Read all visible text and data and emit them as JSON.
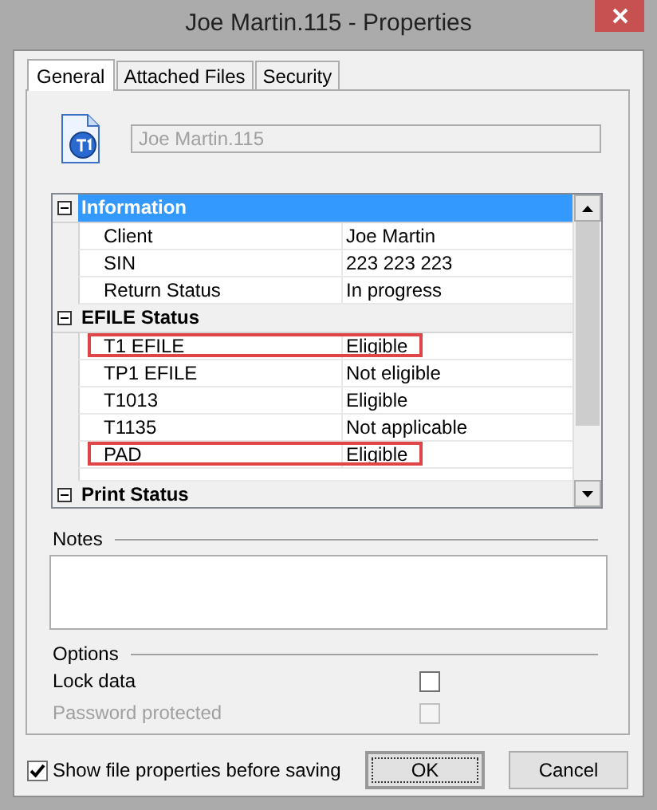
{
  "window": {
    "title": "Joe Martin.115 - Properties"
  },
  "tabs": [
    {
      "label": "General",
      "selected": true
    },
    {
      "label": "Attached Files",
      "selected": false
    },
    {
      "label": "Security",
      "selected": false
    }
  ],
  "file_name": {
    "value": "Joe Martin.115",
    "disabled": true
  },
  "properties": {
    "sections": [
      {
        "title": "Information",
        "selected": true,
        "expanded": true,
        "rows": [
          {
            "name": "Client",
            "value": "Joe Martin",
            "highlighted": false
          },
          {
            "name": "SIN",
            "value": "223 223 223",
            "highlighted": false
          },
          {
            "name": "Return Status",
            "value": "In progress",
            "highlighted": false
          }
        ]
      },
      {
        "title": "EFILE Status",
        "selected": false,
        "expanded": true,
        "rows": [
          {
            "name": "T1 EFILE",
            "value": "Eligible",
            "highlighted": true
          },
          {
            "name": "TP1 EFILE",
            "value": "Not eligible",
            "highlighted": false
          },
          {
            "name": "T1013",
            "value": "Eligible",
            "highlighted": false
          },
          {
            "name": "T1135",
            "value": "Not applicable",
            "highlighted": false
          },
          {
            "name": "PAD",
            "value": "Eligible",
            "highlighted": true
          }
        ]
      },
      {
        "title": "Print Status",
        "selected": false,
        "expanded": true
      }
    ]
  },
  "notes": {
    "label": "Notes"
  },
  "options": {
    "label": "Options",
    "items": [
      {
        "label": "Lock data",
        "checked": false,
        "disabled": false
      },
      {
        "label": "Password protected",
        "checked": false,
        "disabled": true
      }
    ]
  },
  "show_properties": {
    "label": "Show file properties before saving",
    "checked": true
  },
  "buttons": [
    {
      "label": "OK",
      "default": true
    },
    {
      "label": "Cancel",
      "default": false
    }
  ]
}
